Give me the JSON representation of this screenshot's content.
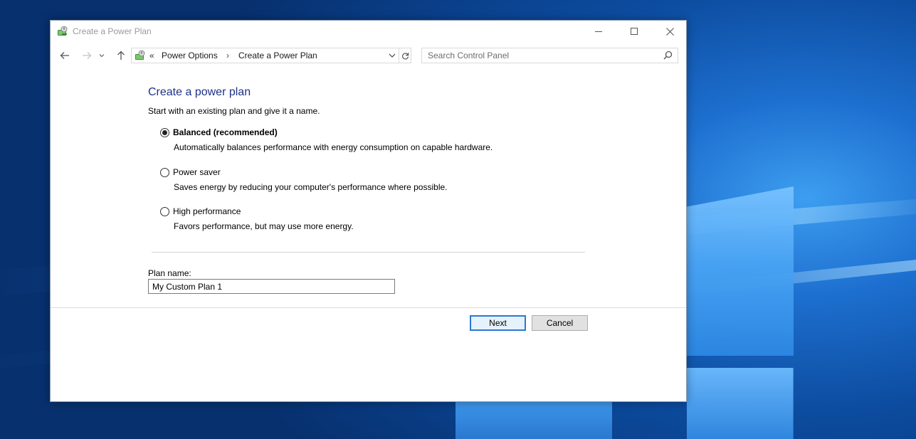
{
  "window": {
    "title": "Create a Power Plan"
  },
  "navbar": {
    "chevron": "«",
    "breadcrumb": [
      "Power Options",
      "Create a Power Plan"
    ],
    "separator": "›",
    "search_placeholder": "Search Control Panel"
  },
  "content": {
    "heading": "Create a power plan",
    "subtext": "Start with an existing plan and give it a name.",
    "options": [
      {
        "label": "Balanced (recommended)",
        "description": "Automatically balances performance with energy consumption on capable hardware.",
        "selected": true
      },
      {
        "label": "Power saver",
        "description": "Saves energy by reducing your computer's performance where possible.",
        "selected": false
      },
      {
        "label": "High performance",
        "description": "Favors performance, but may use more energy.",
        "selected": false
      }
    ],
    "plan_name_label": "Plan name:",
    "plan_name_value": "My Custom Plan 1"
  },
  "buttons": {
    "next": "Next",
    "cancel": "Cancel"
  },
  "icons": {
    "title": "power-options-icon",
    "back": "arrow-left-icon",
    "forward": "arrow-right-icon",
    "recent": "chevron-down-icon",
    "up": "arrow-up-icon",
    "refresh": "refresh-icon",
    "search": "search-icon"
  },
  "colors": {
    "heading": "#1e3287",
    "focus_border": "#2b78d3"
  }
}
